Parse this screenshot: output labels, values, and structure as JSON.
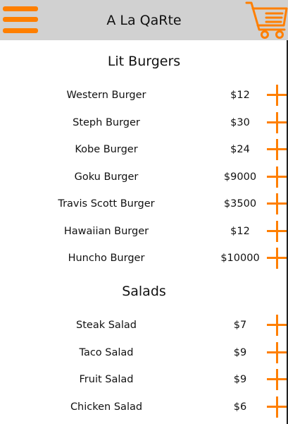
{
  "app": {
    "title": "A La QaRte"
  },
  "icons": {
    "menu": "hamburger-menu-icon",
    "cart": "shopping-cart-icon",
    "add": "plus-icon"
  },
  "colors": {
    "accent": "#ff7f00",
    "app_bar": "#d1d1d1",
    "background": "#ffffff",
    "text": "#111111"
  },
  "sections": [
    {
      "heading": "Lit Burgers",
      "items": [
        {
          "name": "Western Burger",
          "price": "$12"
        },
        {
          "name": "Steph Burger",
          "price": "$30"
        },
        {
          "name": "Kobe Burger",
          "price": "$24"
        },
        {
          "name": "Goku Burger",
          "price": "$9000"
        },
        {
          "name": "Travis Scott Burger",
          "price": "$3500"
        },
        {
          "name": "Hawaiian Burger",
          "price": "$12"
        },
        {
          "name": "Huncho Burger",
          "price": "$10000"
        }
      ]
    },
    {
      "heading": "Salads",
      "items": [
        {
          "name": "Steak Salad",
          "price": "$7"
        },
        {
          "name": "Taco Salad",
          "price": "$9"
        },
        {
          "name": "Fruit Salad",
          "price": "$9"
        },
        {
          "name": "Chicken Salad",
          "price": "$6"
        }
      ]
    }
  ]
}
